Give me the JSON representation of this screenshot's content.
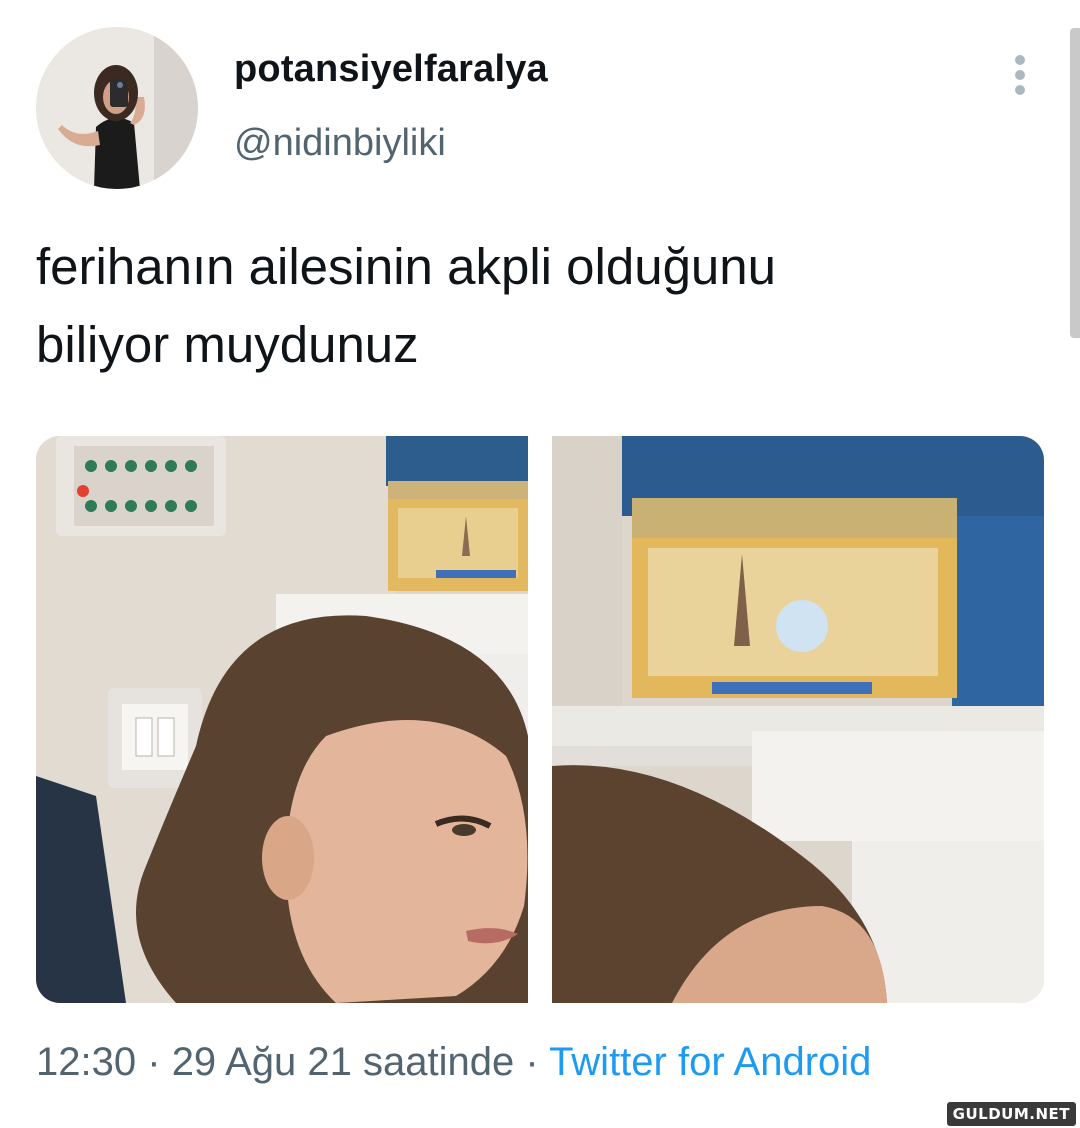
{
  "tweet": {
    "display_name": "potansiyelfaralya",
    "handle": "@nidinbiyliki",
    "text_line1": "ferihanın ailesinin akpli olduğunu",
    "text_line2": "biliyor muydunuz",
    "time": "12:30",
    "separator": "·",
    "date": "29 Ağu 21 saatinde",
    "source": "Twitter for Android"
  },
  "icons": {
    "more": "more-vertical-icon"
  },
  "media": [
    {
      "name": "girl-with-tin-box-photo"
    },
    {
      "name": "tin-box-closeup-photo"
    }
  ],
  "watermark": "GULDUM.NET",
  "colors": {
    "text_primary": "#0f1419",
    "text_secondary": "#536471",
    "link": "#1d9bf0",
    "more_dots": "#aab8c2"
  }
}
